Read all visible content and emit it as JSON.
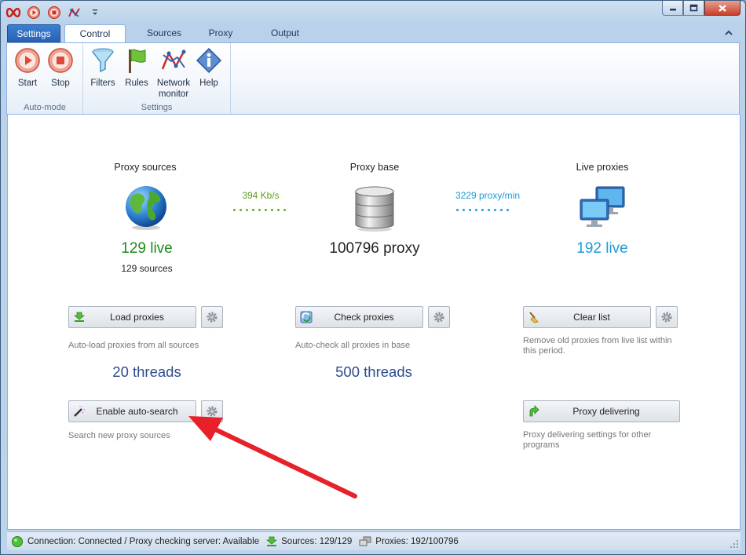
{
  "tabs": {
    "settings": "Settings",
    "control": "Control",
    "sources": "Sources",
    "proxy": "Proxy",
    "output": "Output"
  },
  "ribbon": {
    "automode": {
      "title": "Auto-mode",
      "start": "Start",
      "stop": "Stop"
    },
    "settings": {
      "title": "Settings",
      "filters": "Filters",
      "rules": "Rules",
      "network_monitor": "Network\nmonitor",
      "help": "Help"
    }
  },
  "dashboard": {
    "sources": {
      "title": "Proxy sources",
      "live": "129 live",
      "count": "129 sources"
    },
    "base": {
      "title": "Proxy base",
      "count": "100796 proxy"
    },
    "live": {
      "title": "Live proxies",
      "live": "192 live"
    },
    "rate_in": "394 Kb/s",
    "rate_out": "3229 proxy/min",
    "load": {
      "label": "Load proxies",
      "desc": "Auto-load proxies from all sources",
      "threads": "20 threads"
    },
    "check": {
      "label": "Check proxies",
      "desc": "Auto-check all proxies in base",
      "threads": "500 threads"
    },
    "clear": {
      "label": "Clear list",
      "desc": "Remove old proxies from live list within this period."
    },
    "autosearch": {
      "label": "Enable auto-search",
      "desc": "Search new proxy sources"
    },
    "delivering": {
      "label": "Proxy delivering",
      "desc": "Proxy delivering settings for other programs"
    }
  },
  "status": {
    "connection": "Connection: Connected / Proxy checking server: Available",
    "sources": "Sources: 129/129",
    "proxies": "Proxies: 192/100796"
  },
  "colors": {
    "live_green": "#1d8a1d",
    "live_blue": "#1e9bd7",
    "threads": "#2d4b8f",
    "arrow": "#e8202a"
  }
}
